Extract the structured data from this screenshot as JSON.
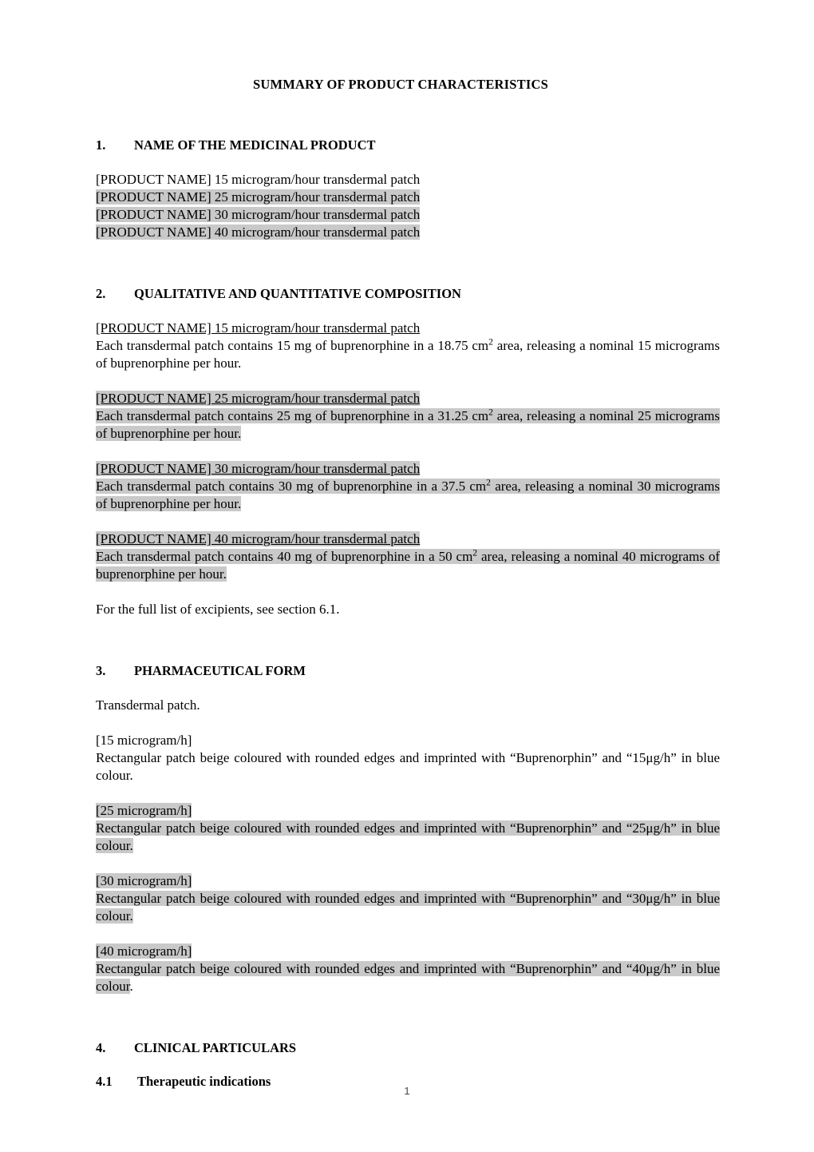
{
  "document": {
    "title": "SUMMARY OF PRODUCT CHARACTERISTICS",
    "page_number": "1",
    "highlight_color": "#c9c9c9"
  },
  "section1": {
    "number": "1.",
    "heading": "NAME OF THE MEDICINAL PRODUCT",
    "product_lines": [
      {
        "text": "[PRODUCT NAME] 15 microgram/hour transdermal patch",
        "highlighted": false
      },
      {
        "text": "[PRODUCT NAME] 25 microgram/hour transdermal patch",
        "highlighted": true
      },
      {
        "text": "[PRODUCT NAME] 30 microgram/hour transdermal patch",
        "highlighted": true
      },
      {
        "text": "[PRODUCT NAME] 40 microgram/hour transdermal patch",
        "highlighted": true
      }
    ]
  },
  "section2": {
    "number": "2.",
    "heading": "QUALITATIVE AND QUANTITATIVE COMPOSITION",
    "blocks": [
      {
        "title": "[PRODUCT NAME] 15 microgram/hour transdermal patch",
        "body_pre": "Each transdermal patch contains 15 mg of buprenorphine in a 18.75 cm",
        "body_sup": "2",
        "body_post": " area, releasing a nominal 15 micrograms of buprenorphine per hour.",
        "highlighted": false
      },
      {
        "title": "[PRODUCT NAME] 25 microgram/hour transdermal patch",
        "body_pre": "Each transdermal patch contains 25 mg of buprenorphine in a 31.25 cm",
        "body_sup": "2",
        "body_post": " area, releasing a nominal 25 micrograms of buprenorphine per hour.",
        "highlighted": true
      },
      {
        "title": "[PRODUCT NAME] 30 microgram/hour transdermal patch",
        "body_pre": "Each transdermal patch contains 30 mg of buprenorphine in a 37.5 cm",
        "body_sup": "2",
        "body_post": " area, releasing a nominal 30 micrograms of buprenorphine per hour.",
        "highlighted": true
      },
      {
        "title": "[PRODUCT NAME] 40 microgram/hour transdermal patch",
        "body_pre": "Each transdermal patch contains 40 mg of buprenorphine in a 50 cm",
        "body_sup": "2",
        "body_post": " area, releasing a nominal 40 micrograms of buprenorphine per hour.",
        "highlighted": true
      }
    ],
    "excipients_note": "For the full list of excipients, see section 6.1."
  },
  "section3": {
    "number": "3.",
    "heading": "PHARMACEUTICAL FORM",
    "form": "Transdermal patch.",
    "blocks": [
      {
        "strength_label": "[15 microgram/h]",
        "description": "Rectangular patch beige coloured with rounded edges and imprinted with “Buprenorphin” and “15μg/h” in blue colour",
        "trailing": ".",
        "highlighted": false
      },
      {
        "strength_label": "[25 microgram/h]",
        "description": "Rectangular patch beige coloured with rounded edges and imprinted with “Buprenorphin” and “25μg/h” in blue colour.",
        "trailing": "",
        "highlighted": true
      },
      {
        "strength_label": "[30 microgram/h]",
        "description": "Rectangular patch beige coloured with rounded edges and imprinted with “Buprenorphin” and “30μg/h” in blue colour.",
        "trailing": "",
        "highlighted": true
      },
      {
        "strength_label": "[40 microgram/h]",
        "description": "Rectangular patch beige coloured with rounded edges and imprinted with “Buprenorphin” and “40μg/h” in blue colour",
        "trailing": ".",
        "highlighted": true
      }
    ]
  },
  "section4": {
    "number": "4.",
    "heading": "CLINICAL PARTICULARS",
    "subsection": {
      "number": "4.1",
      "heading": "Therapeutic indications"
    }
  }
}
